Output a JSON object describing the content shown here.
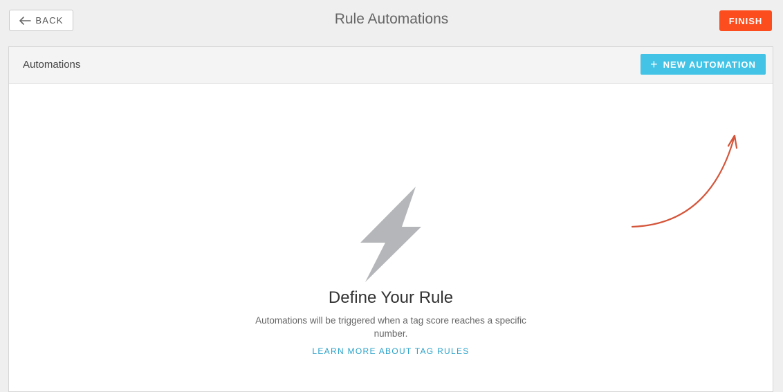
{
  "header": {
    "back_label": "BACK",
    "title": "Rule Automations",
    "finish_label": "FINISH"
  },
  "panel": {
    "title": "Automations",
    "new_button_label": "NEW AUTOMATION",
    "new_button_icon": "plus-icon"
  },
  "empty_state": {
    "icon": "lightning-bolt-icon",
    "title": "Define Your Rule",
    "description": "Automations will be triggered when a tag score reaches a specific number.",
    "link_label": "LEARN MORE ABOUT TAG RULES"
  },
  "colors": {
    "finish": "#fb4d1d",
    "new_automation": "#43c3e6",
    "link": "#2aa2c9",
    "arrow": "#d4553a",
    "bolt": "#b5b6b9"
  }
}
